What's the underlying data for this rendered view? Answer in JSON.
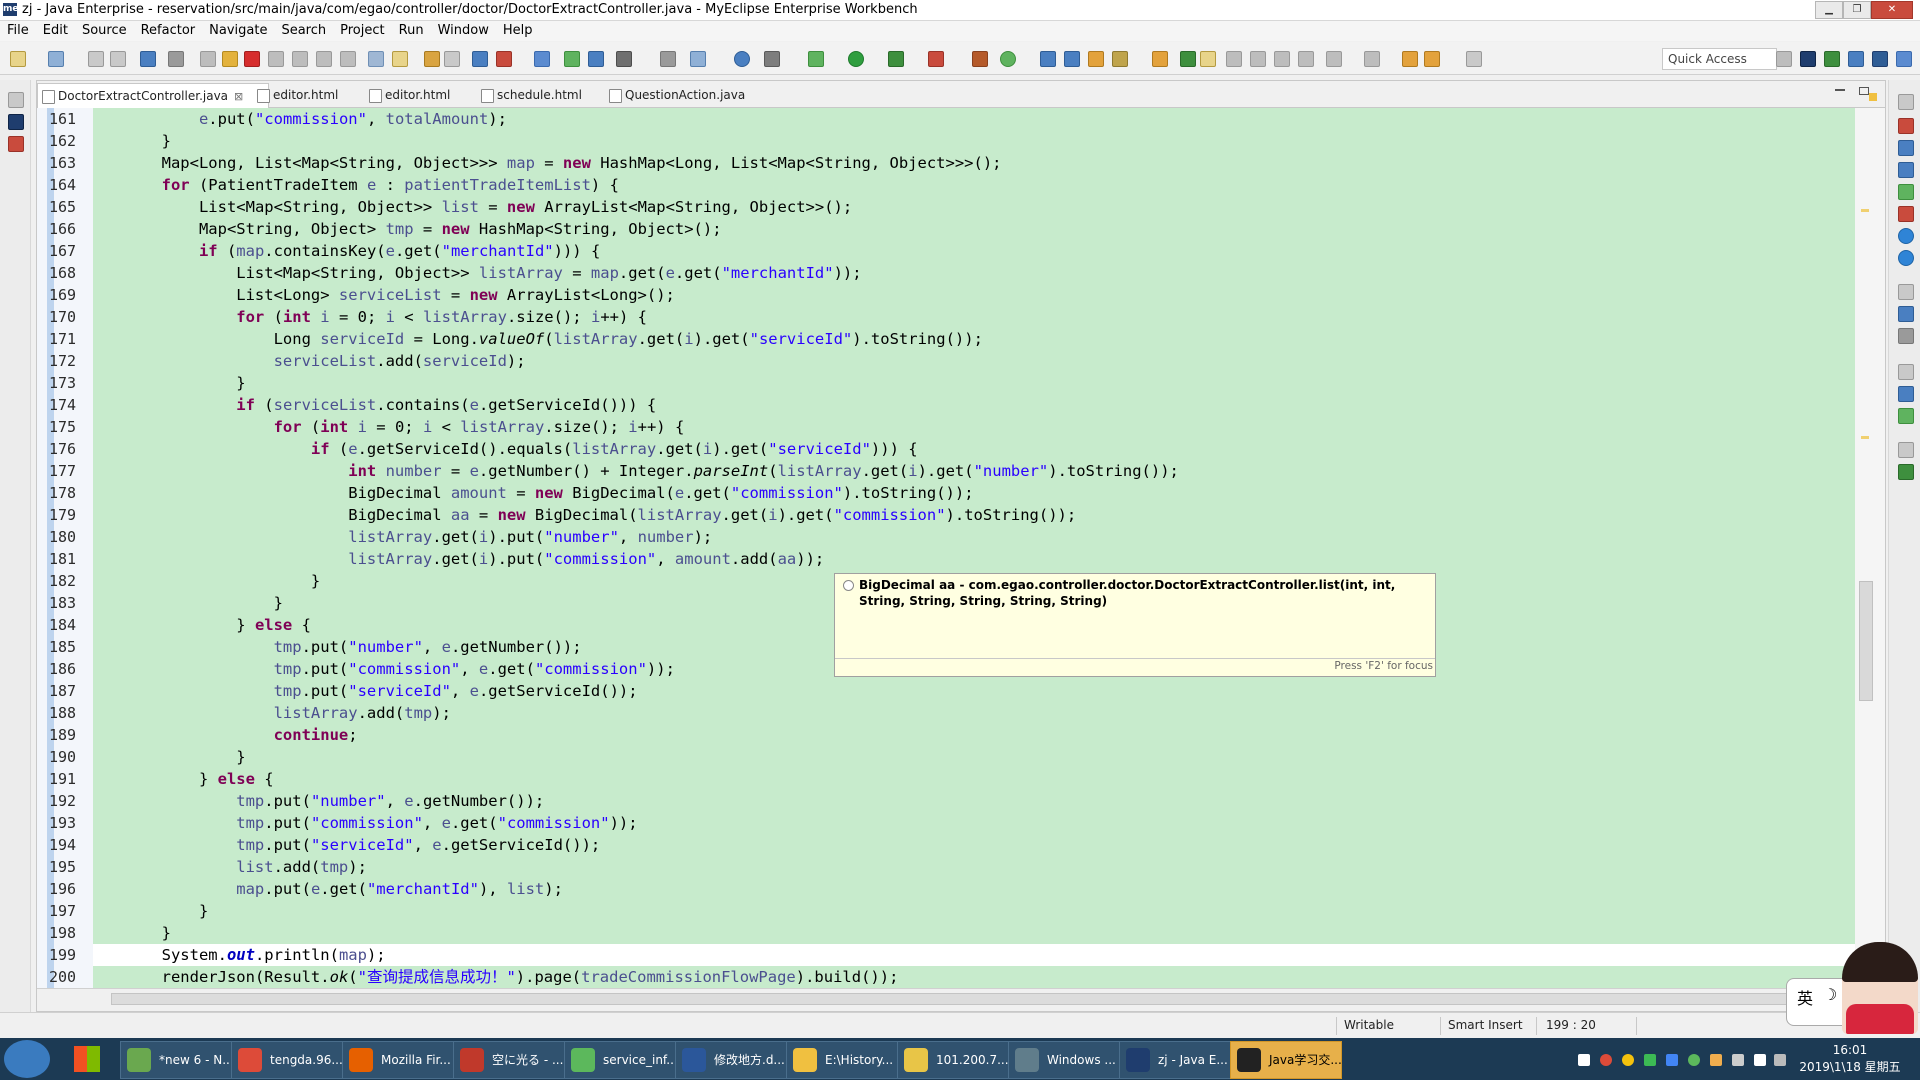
{
  "window": {
    "title": "zj - Java Enterprise - reservation/src/main/java/com/egao/controller/doctor/DoctorExtractController.java - MyEclipse Enterprise Workbench",
    "app_icon": "me",
    "min_glyph": "▁",
    "max_glyph": "❐",
    "close_glyph": "✕"
  },
  "menu": [
    "File",
    "Edit",
    "Source",
    "Refactor",
    "Navigate",
    "Search",
    "Project",
    "Run",
    "Window",
    "Help"
  ],
  "toolbar": {
    "quick_access_placeholder": "Quick Access"
  },
  "tabs": [
    {
      "label": "DoctorExtractController.java",
      "active": true,
      "close": "⊠"
    },
    {
      "label": "editor.html",
      "active": false
    },
    {
      "label": "editor.html",
      "active": false
    },
    {
      "label": "schedule.html",
      "active": false
    },
    {
      "label": "QuestionAction.java",
      "active": false
    }
  ],
  "code_lines": [
    {
      "n": "161",
      "indent": 3,
      "parts": [
        [
          "v",
          "e"
        ],
        [
          "t",
          ".put("
        ],
        [
          "s",
          "\"commission\""
        ],
        [
          "t",
          ", "
        ],
        [
          "v",
          "totalAmount"
        ],
        [
          "t",
          ");"
        ]
      ]
    },
    {
      "n": "162",
      "indent": 2,
      "parts": [
        [
          "t",
          "}"
        ]
      ]
    },
    {
      "n": "163",
      "indent": 2,
      "parts": [
        [
          "t",
          "Map<Long, List<Map<String, Object>>> "
        ],
        [
          "v",
          "map"
        ],
        [
          "t",
          " = "
        ],
        [
          "k",
          "new"
        ],
        [
          "t",
          " HashMap<Long, List<Map<String, Object>>>();"
        ]
      ]
    },
    {
      "n": "164",
      "indent": 2,
      "parts": [
        [
          "k",
          "for"
        ],
        [
          "t",
          " (PatientTradeItem "
        ],
        [
          "v",
          "e"
        ],
        [
          "t",
          " : "
        ],
        [
          "v",
          "patientTradeItemList"
        ],
        [
          "t",
          ") {"
        ]
      ]
    },
    {
      "n": "165",
      "indent": 3,
      "parts": [
        [
          "t",
          "List<Map<String, Object>> "
        ],
        [
          "v",
          "list"
        ],
        [
          "t",
          " = "
        ],
        [
          "k",
          "new"
        ],
        [
          "t",
          " ArrayList<Map<String, Object>>();"
        ]
      ]
    },
    {
      "n": "166",
      "indent": 3,
      "parts": [
        [
          "t",
          "Map<String, Object> "
        ],
        [
          "v",
          "tmp"
        ],
        [
          "t",
          " = "
        ],
        [
          "k",
          "new"
        ],
        [
          "t",
          " HashMap<String, Object>();"
        ]
      ]
    },
    {
      "n": "167",
      "indent": 3,
      "parts": [
        [
          "k",
          "if"
        ],
        [
          "t",
          " ("
        ],
        [
          "v",
          "map"
        ],
        [
          "t",
          ".containsKey("
        ],
        [
          "v",
          "e"
        ],
        [
          "t",
          ".get("
        ],
        [
          "s",
          "\"merchantId\""
        ],
        [
          "t",
          "))) {"
        ]
      ]
    },
    {
      "n": "168",
      "indent": 4,
      "parts": [
        [
          "t",
          "List<Map<String, Object>> "
        ],
        [
          "v",
          "listArray"
        ],
        [
          "t",
          " = "
        ],
        [
          "v",
          "map"
        ],
        [
          "t",
          ".get("
        ],
        [
          "v",
          "e"
        ],
        [
          "t",
          ".get("
        ],
        [
          "s",
          "\"merchantId\""
        ],
        [
          "t",
          "));"
        ]
      ]
    },
    {
      "n": "169",
      "indent": 4,
      "parts": [
        [
          "t",
          "List<Long> "
        ],
        [
          "v",
          "serviceList"
        ],
        [
          "t",
          " = "
        ],
        [
          "k",
          "new"
        ],
        [
          "t",
          " ArrayList<Long>();"
        ]
      ]
    },
    {
      "n": "170",
      "indent": 4,
      "parts": [
        [
          "k",
          "for"
        ],
        [
          "t",
          " ("
        ],
        [
          "k",
          "int"
        ],
        [
          "t",
          " "
        ],
        [
          "v",
          "i"
        ],
        [
          "t",
          " = 0; "
        ],
        [
          "v",
          "i"
        ],
        [
          "t",
          " < "
        ],
        [
          "v",
          "listArray"
        ],
        [
          "t",
          ".size(); "
        ],
        [
          "v",
          "i"
        ],
        [
          "t",
          "++) {"
        ]
      ]
    },
    {
      "n": "171",
      "indent": 5,
      "parts": [
        [
          "t",
          "Long "
        ],
        [
          "v",
          "serviceId"
        ],
        [
          "t",
          " = Long."
        ],
        [
          "i",
          "valueOf"
        ],
        [
          "t",
          "("
        ],
        [
          "v",
          "listArray"
        ],
        [
          "t",
          ".get("
        ],
        [
          "v",
          "i"
        ],
        [
          "t",
          ").get("
        ],
        [
          "s",
          "\"serviceId\""
        ],
        [
          "t",
          ").toString());"
        ]
      ]
    },
    {
      "n": "172",
      "indent": 5,
      "parts": [
        [
          "v",
          "serviceList"
        ],
        [
          "t",
          ".add("
        ],
        [
          "v",
          "serviceId"
        ],
        [
          "t",
          ");"
        ]
      ]
    },
    {
      "n": "173",
      "indent": 4,
      "parts": [
        [
          "t",
          "}"
        ]
      ]
    },
    {
      "n": "174",
      "indent": 4,
      "parts": [
        [
          "k",
          "if"
        ],
        [
          "t",
          " ("
        ],
        [
          "v",
          "serviceList"
        ],
        [
          "t",
          ".contains("
        ],
        [
          "v",
          "e"
        ],
        [
          "t",
          ".getServiceId())) {"
        ]
      ]
    },
    {
      "n": "175",
      "indent": 5,
      "parts": [
        [
          "k",
          "for"
        ],
        [
          "t",
          " ("
        ],
        [
          "k",
          "int"
        ],
        [
          "t",
          " "
        ],
        [
          "v",
          "i"
        ],
        [
          "t",
          " = 0; "
        ],
        [
          "v",
          "i"
        ],
        [
          "t",
          " < "
        ],
        [
          "v",
          "listArray"
        ],
        [
          "t",
          ".size(); "
        ],
        [
          "v",
          "i"
        ],
        [
          "t",
          "++) {"
        ]
      ]
    },
    {
      "n": "176",
      "indent": 6,
      "parts": [
        [
          "k",
          "if"
        ],
        [
          "t",
          " ("
        ],
        [
          "v",
          "e"
        ],
        [
          "t",
          ".getServiceId().equals("
        ],
        [
          "v",
          "listArray"
        ],
        [
          "t",
          ".get("
        ],
        [
          "v",
          "i"
        ],
        [
          "t",
          ").get("
        ],
        [
          "s",
          "\"serviceId\""
        ],
        [
          "t",
          "))) {"
        ]
      ]
    },
    {
      "n": "177",
      "indent": 7,
      "parts": [
        [
          "k",
          "int"
        ],
        [
          "t",
          " "
        ],
        [
          "v",
          "number"
        ],
        [
          "t",
          " = "
        ],
        [
          "v",
          "e"
        ],
        [
          "t",
          ".getNumber() + Integer."
        ],
        [
          "i",
          "parseInt"
        ],
        [
          "t",
          "("
        ],
        [
          "v",
          "listArray"
        ],
        [
          "t",
          ".get("
        ],
        [
          "v",
          "i"
        ],
        [
          "t",
          ").get("
        ],
        [
          "s",
          "\"number\""
        ],
        [
          "t",
          ").toString());"
        ]
      ]
    },
    {
      "n": "178",
      "indent": 7,
      "parts": [
        [
          "t",
          "BigDecimal "
        ],
        [
          "v",
          "amount"
        ],
        [
          "t",
          " = "
        ],
        [
          "k",
          "new"
        ],
        [
          "t",
          " BigDecimal("
        ],
        [
          "v",
          "e"
        ],
        [
          "t",
          ".get("
        ],
        [
          "s",
          "\"commission\""
        ],
        [
          "t",
          ").toString());"
        ]
      ]
    },
    {
      "n": "179",
      "indent": 7,
      "parts": [
        [
          "t",
          "BigDecimal "
        ],
        [
          "v",
          "aa"
        ],
        [
          "t",
          " = "
        ],
        [
          "k",
          "new"
        ],
        [
          "t",
          " BigDecimal("
        ],
        [
          "v",
          "listArray"
        ],
        [
          "t",
          ".get("
        ],
        [
          "v",
          "i"
        ],
        [
          "t",
          ").get("
        ],
        [
          "s",
          "\"commission\""
        ],
        [
          "t",
          ").toString());"
        ]
      ]
    },
    {
      "n": "180",
      "indent": 7,
      "parts": [
        [
          "v",
          "listArray"
        ],
        [
          "t",
          ".get("
        ],
        [
          "v",
          "i"
        ],
        [
          "t",
          ").put("
        ],
        [
          "s",
          "\"number\""
        ],
        [
          "t",
          ", "
        ],
        [
          "v",
          "number"
        ],
        [
          "t",
          ");"
        ]
      ]
    },
    {
      "n": "181",
      "indent": 7,
      "parts": [
        [
          "v",
          "listArray"
        ],
        [
          "t",
          ".get("
        ],
        [
          "v",
          "i"
        ],
        [
          "t",
          ").put("
        ],
        [
          "s",
          "\"commission\""
        ],
        [
          "t",
          ", "
        ],
        [
          "v",
          "amount"
        ],
        [
          "t",
          ".add("
        ],
        [
          "v",
          "aa"
        ],
        [
          "t",
          "));"
        ]
      ]
    },
    {
      "n": "182",
      "indent": 6,
      "parts": [
        [
          "t",
          "}"
        ]
      ]
    },
    {
      "n": "183",
      "indent": 5,
      "parts": [
        [
          "t",
          "}"
        ]
      ]
    },
    {
      "n": "184",
      "indent": 4,
      "parts": [
        [
          "t",
          "} "
        ],
        [
          "k",
          "else"
        ],
        [
          "t",
          " {"
        ]
      ]
    },
    {
      "n": "185",
      "indent": 5,
      "parts": [
        [
          "v",
          "tmp"
        ],
        [
          "t",
          ".put("
        ],
        [
          "s",
          "\"number\""
        ],
        [
          "t",
          ", "
        ],
        [
          "v",
          "e"
        ],
        [
          "t",
          ".getNumber());"
        ]
      ]
    },
    {
      "n": "186",
      "indent": 5,
      "parts": [
        [
          "v",
          "tmp"
        ],
        [
          "t",
          ".put("
        ],
        [
          "s",
          "\"commission\""
        ],
        [
          "t",
          ", "
        ],
        [
          "v",
          "e"
        ],
        [
          "t",
          ".get("
        ],
        [
          "s",
          "\"commission\""
        ],
        [
          "t",
          "));"
        ]
      ]
    },
    {
      "n": "187",
      "indent": 5,
      "parts": [
        [
          "v",
          "tmp"
        ],
        [
          "t",
          ".put("
        ],
        [
          "s",
          "\"serviceId\""
        ],
        [
          "t",
          ", "
        ],
        [
          "v",
          "e"
        ],
        [
          "t",
          ".getServiceId());"
        ]
      ]
    },
    {
      "n": "188",
      "indent": 5,
      "parts": [
        [
          "v",
          "listArray"
        ],
        [
          "t",
          ".add("
        ],
        [
          "v",
          "tmp"
        ],
        [
          "t",
          ");"
        ]
      ]
    },
    {
      "n": "189",
      "indent": 5,
      "parts": [
        [
          "k",
          "continue"
        ],
        [
          "t",
          ";"
        ]
      ]
    },
    {
      "n": "190",
      "indent": 4,
      "parts": [
        [
          "t",
          "}"
        ]
      ]
    },
    {
      "n": "191",
      "indent": 3,
      "parts": [
        [
          "t",
          "} "
        ],
        [
          "k",
          "else"
        ],
        [
          "t",
          " {"
        ]
      ]
    },
    {
      "n": "192",
      "indent": 4,
      "parts": [
        [
          "v",
          "tmp"
        ],
        [
          "t",
          ".put("
        ],
        [
          "s",
          "\"number\""
        ],
        [
          "t",
          ", "
        ],
        [
          "v",
          "e"
        ],
        [
          "t",
          ".getNumber());"
        ]
      ]
    },
    {
      "n": "193",
      "indent": 4,
      "parts": [
        [
          "v",
          "tmp"
        ],
        [
          "t",
          ".put("
        ],
        [
          "s",
          "\"commission\""
        ],
        [
          "t",
          ", "
        ],
        [
          "v",
          "e"
        ],
        [
          "t",
          ".get("
        ],
        [
          "s",
          "\"commission\""
        ],
        [
          "t",
          "));"
        ]
      ]
    },
    {
      "n": "194",
      "indent": 4,
      "parts": [
        [
          "v",
          "tmp"
        ],
        [
          "t",
          ".put("
        ],
        [
          "s",
          "\"serviceId\""
        ],
        [
          "t",
          ", "
        ],
        [
          "v",
          "e"
        ],
        [
          "t",
          ".getServiceId());"
        ]
      ]
    },
    {
      "n": "195",
      "indent": 4,
      "parts": [
        [
          "v",
          "list"
        ],
        [
          "t",
          ".add("
        ],
        [
          "v",
          "tmp"
        ],
        [
          "t",
          ");"
        ]
      ]
    },
    {
      "n": "196",
      "indent": 4,
      "parts": [
        [
          "v",
          "map"
        ],
        [
          "t",
          ".put("
        ],
        [
          "v",
          "e"
        ],
        [
          "t",
          ".get("
        ],
        [
          "s",
          "\"merchantId\""
        ],
        [
          "t",
          "), "
        ],
        [
          "v",
          "list"
        ],
        [
          "t",
          ");"
        ]
      ]
    },
    {
      "n": "197",
      "indent": 3,
      "parts": [
        [
          "t",
          "}"
        ]
      ]
    },
    {
      "n": "198",
      "indent": 2,
      "parts": [
        [
          "t",
          "}"
        ]
      ]
    },
    {
      "n": "199",
      "indent": 2,
      "current": true,
      "parts": [
        [
          "t",
          "System."
        ],
        [
          "f",
          "out"
        ],
        [
          "t",
          ".println("
        ],
        [
          "v",
          "map"
        ],
        [
          "t",
          ");"
        ]
      ]
    },
    {
      "n": "200",
      "indent": 2,
      "parts": [
        [
          "t",
          "renderJson(Result."
        ],
        [
          "i",
          "ok"
        ],
        [
          "t",
          "("
        ],
        [
          "s",
          "\"查询提成信息成功！\""
        ],
        [
          "t",
          ").page("
        ],
        [
          "v",
          "tradeCommissionFlowPage"
        ],
        [
          "t",
          ").build());"
        ]
      ]
    }
  ],
  "tooltip": {
    "text": "BigDecimal aa - com.egao.controller.doctor.DoctorExtractController.list(int, int, String, String, String, String, String)",
    "focus_hint": "Press 'F2' for focus"
  },
  "status": {
    "writable": "Writable",
    "insert_mode": "Smart Insert",
    "position": "199 : 20"
  },
  "taskbar": {
    "items": [
      {
        "label": "*new 6 - N...",
        "color": "#6aa84f"
      },
      {
        "label": "tengda.96...",
        "color": "#dd4b39"
      },
      {
        "label": "Mozilla Fir...",
        "color": "#e66000"
      },
      {
        "label": "空に光る - ...",
        "color": "#c0392b"
      },
      {
        "label": "service_inf...",
        "color": "#5cb85c"
      },
      {
        "label": "修改地方.d...",
        "color": "#2b579a"
      },
      {
        "label": "E:\\History...",
        "color": "#f0c040"
      },
      {
        "label": "101.200.7...",
        "color": "#e8c547"
      },
      {
        "label": "Windows ...",
        "color": "#607d8b"
      },
      {
        "label": "zj - Java E...",
        "color": "#1f3d6e"
      },
      {
        "label": "Java学习交...",
        "color": "#222222",
        "active": true
      }
    ],
    "ime_label": "英",
    "clock_time": "16:01",
    "clock_date": "2019\\1\\18 星期五"
  }
}
